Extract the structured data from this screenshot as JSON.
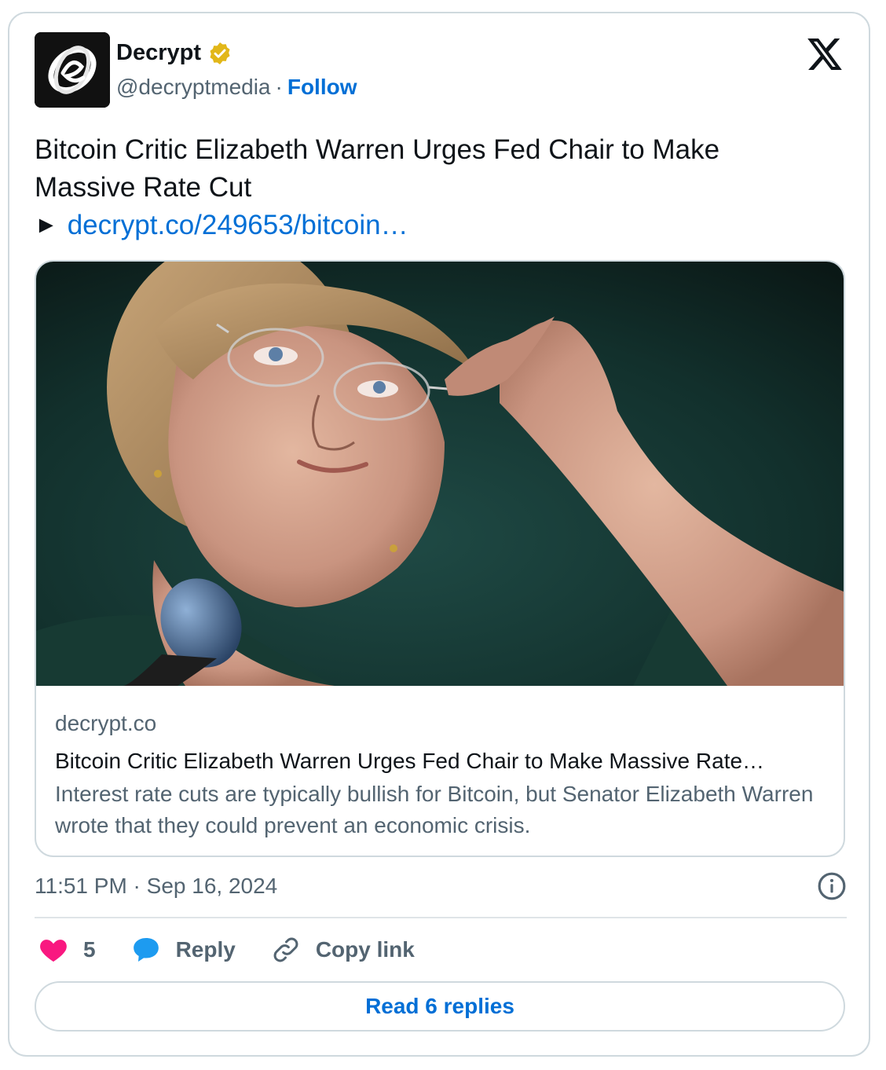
{
  "account": {
    "name": "Decrypt",
    "handle": "@decryptmedia",
    "separator": "·",
    "follow_label": "Follow",
    "verified_color": "#e2b719"
  },
  "tweet": {
    "text_line1": "Bitcoin Critic Elizabeth Warren Urges Fed Chair to Make",
    "text_line2": "Massive Rate Cut",
    "arrow": "►",
    "link_text": "decrypt.co/249653/bitcoin…"
  },
  "link_card": {
    "domain": "decrypt.co",
    "title": "Bitcoin Critic Elizabeth Warren Urges Fed Chair to Make Massive Rate…",
    "description": "Interest rate cuts are typically bullish for Bitcoin, but Senator Elizabeth Warren wrote that they could prevent an economic crisis.",
    "image_icon": "portrait-photo"
  },
  "timestamp": "11:51 PM · Sep 16, 2024",
  "actions": {
    "like_count": "5",
    "reply_label": "Reply",
    "copy_link_label": "Copy link"
  },
  "read_replies_label": "Read 6 replies",
  "colors": {
    "link_blue": "#006fd6",
    "heart": "#f91880",
    "reply_bubble": "#1d9bf0",
    "muted": "#536471",
    "border": "#cfd9de"
  }
}
